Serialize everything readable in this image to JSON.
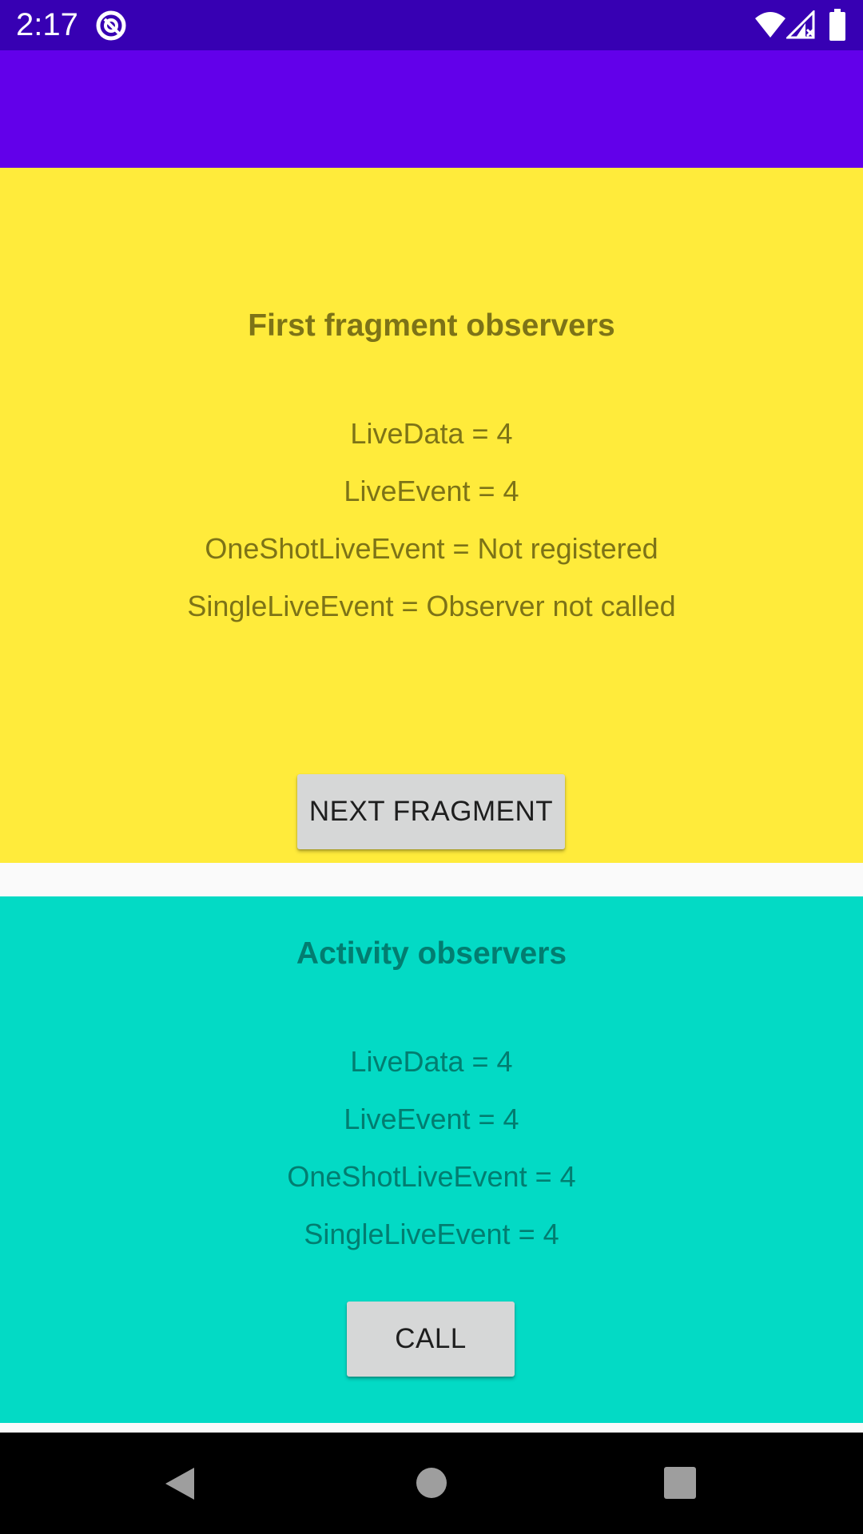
{
  "status_bar": {
    "time": "2:17",
    "icons": [
      "app-notification-icon",
      "wifi-icon",
      "cellular-signal-icon",
      "battery-icon"
    ]
  },
  "colors": {
    "status_bar": "#3700b3",
    "app_bar": "#6200ea",
    "fragment_background": "#ffeb3b",
    "activity_background": "#03dac5",
    "button": "#d6d7d7"
  },
  "fragment": {
    "title": "First fragment observers",
    "lines": [
      "LiveData = 4",
      "LiveEvent = 4",
      "OneShotLiveEvent = Not registered",
      "SingleLiveEvent = Observer not called"
    ],
    "next_button_label": "NEXT FRAGMENT"
  },
  "activity": {
    "title": "Activity observers",
    "lines": [
      "LiveData = 4",
      "LiveEvent = 4",
      "OneShotLiveEvent = 4",
      "SingleLiveEvent = 4"
    ],
    "call_button_label": "CALL"
  },
  "nav_bar": {
    "icons": [
      "back-icon",
      "home-icon",
      "recents-icon"
    ]
  }
}
